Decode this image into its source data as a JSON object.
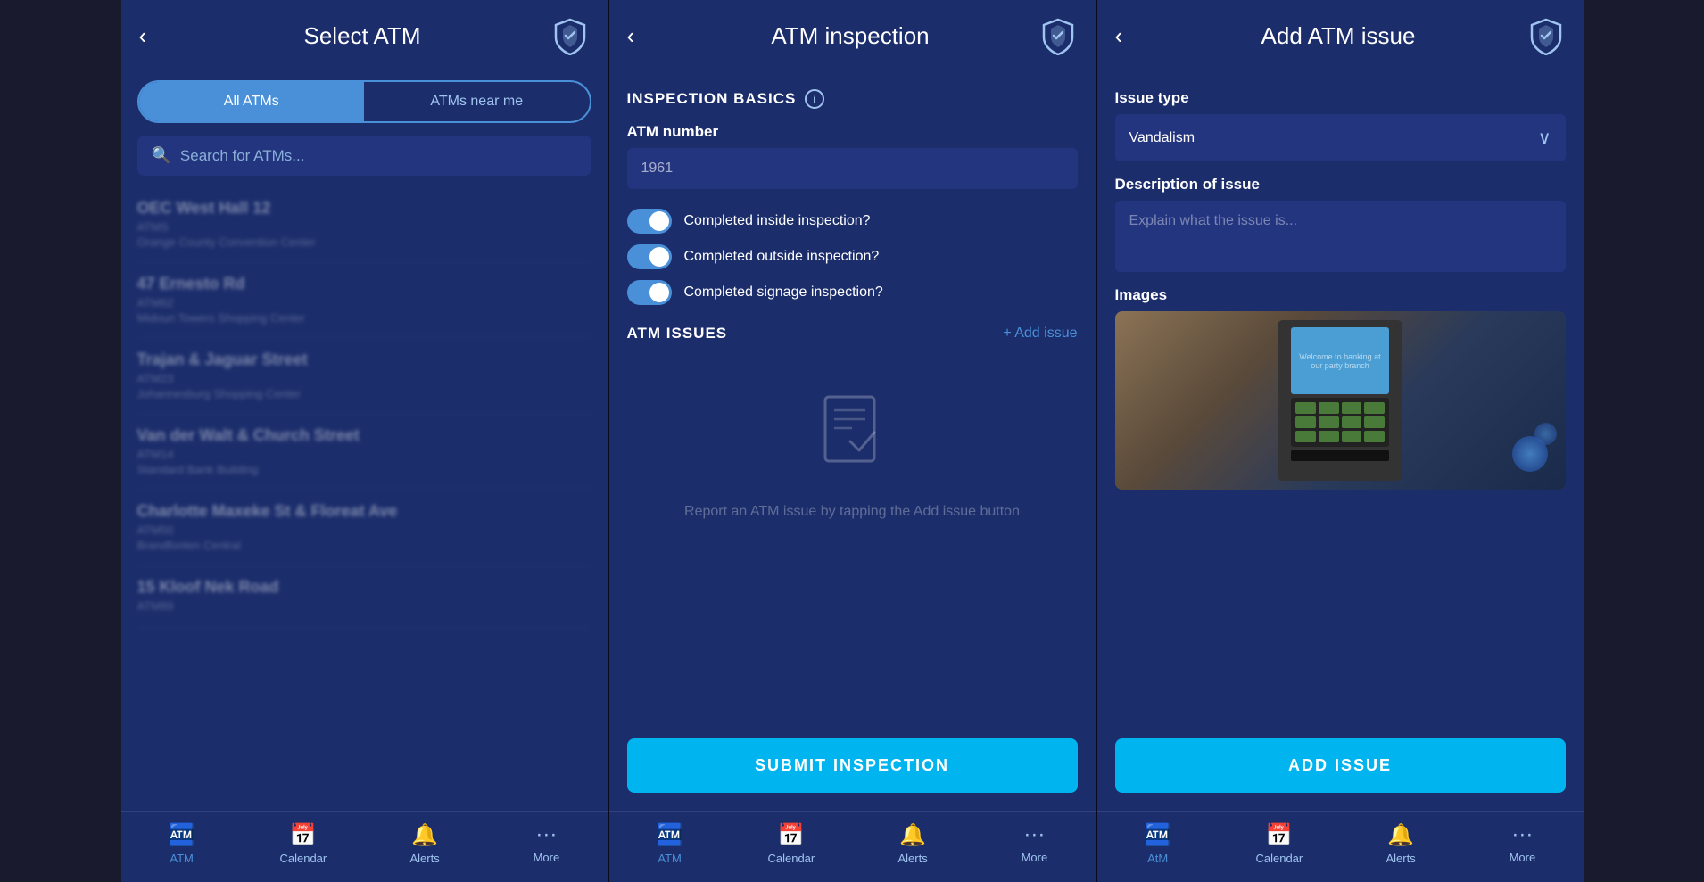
{
  "screen1": {
    "header": {
      "back_icon": "‹",
      "title": "Select ATM",
      "logo_alt": "Standard Bank Shield"
    },
    "tabs": {
      "all_atms": "All ATMs",
      "near_me": "ATMs near me"
    },
    "search": {
      "placeholder": "Search for ATMs..."
    },
    "atm_list": [
      {
        "name": "OEC West Hall 12",
        "code": "ATMS",
        "location": "Orange County Convention Center"
      },
      {
        "name": "47 Ernesto Rd",
        "code": "ATM62",
        "location": "Midouri Towers Shopping Center"
      },
      {
        "name": "Trajan & Jaguar Street",
        "code": "ATM23",
        "location": "Johannesburg Shopping Center"
      },
      {
        "name": "Van der Walt & Church Street",
        "code": "ATM14",
        "location": "Standard Bank Building"
      },
      {
        "name": "Charlotte Maxeke St & Floreat Ave",
        "code": "ATM50",
        "location": "Brandfonten Central"
      },
      {
        "name": "15 Kloof Nek Road",
        "code": "ATM89",
        "location": ""
      }
    ],
    "nav": {
      "atm_label": "ATM",
      "calendar_label": "Calendar",
      "alerts_label": "Alerts",
      "more_label": "More"
    }
  },
  "screen2": {
    "header": {
      "back_icon": "‹",
      "title": "ATM inspection",
      "logo_alt": "Standard Bank Shield"
    },
    "section_basics": "INSPECTION BASICS",
    "atm_number_label": "ATM number",
    "atm_number_value": "1961",
    "toggles": [
      {
        "label": "Completed inside inspection?",
        "checked": true
      },
      {
        "label": "Completed outside inspection?",
        "checked": true
      },
      {
        "label": "Completed signage inspection?",
        "checked": true
      }
    ],
    "section_issues": "ATM ISSUES",
    "add_issue_label": "+ Add issue",
    "empty_text": "Report an ATM issue by\ntapping the Add issue button",
    "submit_btn": "SUBMIT INSPECTION",
    "nav": {
      "atm_label": "ATM",
      "calendar_label": "Calendar",
      "alerts_label": "Alerts",
      "more_label": "More"
    }
  },
  "screen3": {
    "header": {
      "back_icon": "‹",
      "title": "Add ATM issue",
      "logo_alt": "Standard Bank Shield"
    },
    "issue_type_label": "Issue type",
    "issue_type_value": "Vandalism",
    "description_label": "Description of issue",
    "description_placeholder": "Explain what the issue is...",
    "images_label": "Images",
    "atm_screen_text": "Welcome to banking\nat our party branch",
    "submit_btn": "ADD ISSUE",
    "nav": {
      "atm_label": "AtM",
      "calendar_label": "Calendar",
      "alerts_label": "Alerts",
      "more_label": "More"
    }
  },
  "colors": {
    "primary_bg": "#1b2d6b",
    "secondary_bg": "#243580",
    "accent": "#4a90d9",
    "cyan": "#00b4f0",
    "text_primary": "#ffffff",
    "text_muted": "rgba(255,255,255,0.45)"
  }
}
